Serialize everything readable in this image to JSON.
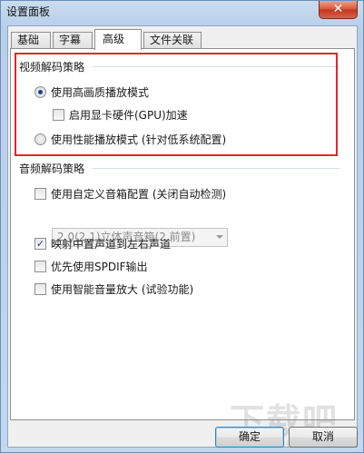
{
  "window": {
    "title": "设置面板",
    "close_label": "✕"
  },
  "tabs": [
    {
      "label": "基础"
    },
    {
      "label": "字幕"
    },
    {
      "label": "高级",
      "active": true
    },
    {
      "label": "文件关联"
    }
  ],
  "video_group": {
    "title": "视频解码策略",
    "options": {
      "high_quality": {
        "label": "使用高画质播放模式",
        "checked": true
      },
      "gpu_accel": {
        "label": "启用显卡硬件(GPU)加速",
        "checked": false
      },
      "performance": {
        "label": "使用性能播放模式 (针对低系统配置)",
        "checked": false
      }
    }
  },
  "audio_group": {
    "title": "音频解码策略",
    "custom_speaker": {
      "label": "使用自定义音箱配置 (关闭自动检测)",
      "checked": false
    },
    "speaker_select": {
      "value": "2.0(2.1)立体声音箱(2 前置)"
    },
    "map_center": {
      "label": "映射中置声道到左右声道",
      "checked": true
    },
    "spdif": {
      "label": "优先使用SPDIF输出",
      "checked": false
    },
    "smart_volume": {
      "label": "使用智能音量放大 (试验功能)",
      "checked": false
    }
  },
  "buttons": {
    "ok": "确定",
    "cancel": "取消"
  },
  "watermark": {
    "text": "下载吧",
    "url": "www.xiazaiba.com"
  },
  "colors": {
    "highlight": "#e2262b",
    "check": "#1e3f8a",
    "title_bar": "#c9dcf0"
  }
}
